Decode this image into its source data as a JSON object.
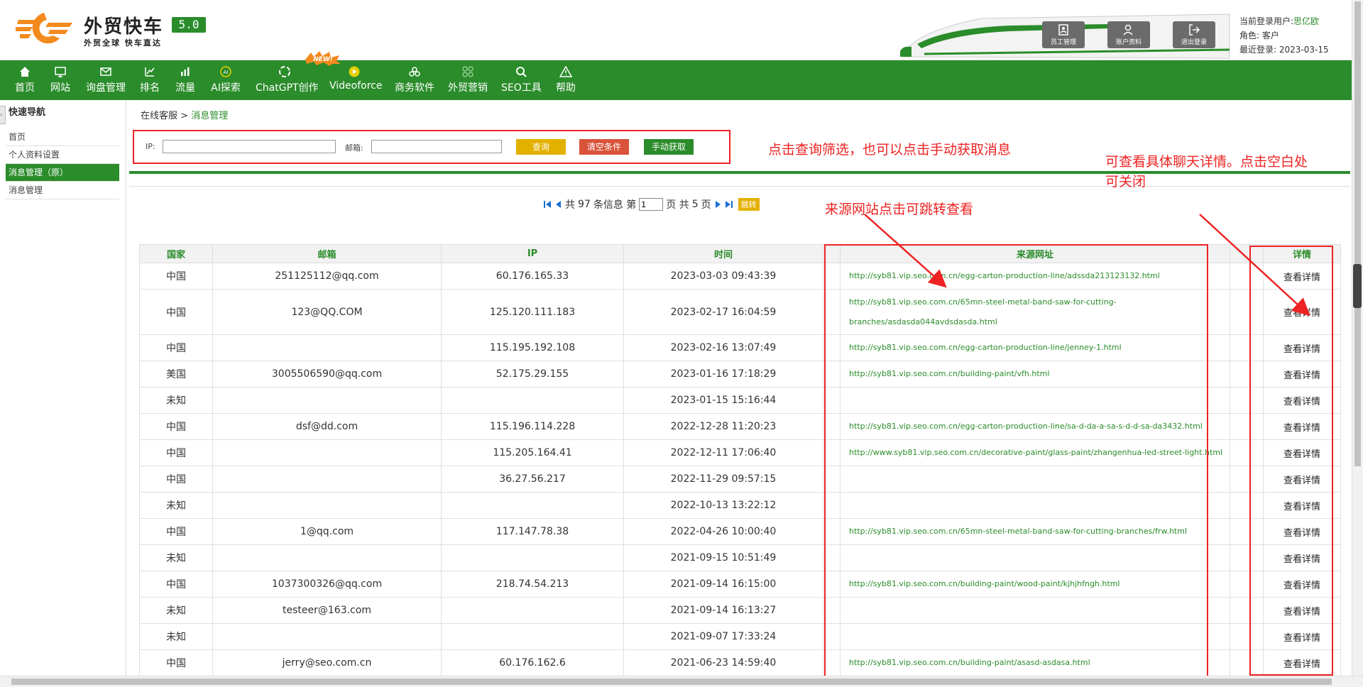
{
  "brand": {
    "title": "外贸快车",
    "version": "5.0",
    "slogan": "外贸全球 快车直达"
  },
  "header_buttons": [
    {
      "label": "员工管理",
      "icon": "staff-icon"
    },
    {
      "label": "账户资料",
      "icon": "account-icon"
    },
    {
      "label": "退出登录",
      "icon": "logout-icon"
    }
  ],
  "user": {
    "login_label": "当前登录用户:",
    "login_name": "思亿欧",
    "role_label": "角色:",
    "role": "客户",
    "last_label": "最近登录:",
    "last_date": "2023-03-15"
  },
  "nav": [
    {
      "label": "首页",
      "icon": "home-icon"
    },
    {
      "label": "网站",
      "icon": "monitor-icon"
    },
    {
      "label": "询盘管理",
      "icon": "mail-icon"
    },
    {
      "label": "排名",
      "icon": "ranking-icon"
    },
    {
      "label": "流量",
      "icon": "bar-chart-icon"
    },
    {
      "label": "AI探索",
      "icon": "ai-icon"
    },
    {
      "label": "ChatGPT创作",
      "icon": "chatgpt-icon"
    },
    {
      "label": "Videoforce",
      "icon": "play-icon"
    },
    {
      "label": "商务软件",
      "icon": "software-icon"
    },
    {
      "label": "外贸营销",
      "icon": "marketing-icon"
    },
    {
      "label": "SEO工具",
      "icon": "search-icon"
    },
    {
      "label": "帮助",
      "icon": "warning-icon"
    }
  ],
  "new_badge": "NEW!",
  "sidebar": {
    "title": "快速导航",
    "items": [
      {
        "label": "首页",
        "active": false
      },
      {
        "label": "个人资料设置",
        "active": false
      },
      {
        "label": "消息管理（原）",
        "active": true
      },
      {
        "label": "消息管理",
        "active": false
      }
    ]
  },
  "breadcrumb": {
    "parent": "在线客服",
    "sep": ">",
    "current": "消息管理"
  },
  "filter": {
    "ip_label": "IP:",
    "email_label": "邮箱:",
    "query": "查询",
    "clear": "清空条件",
    "manual": "手动获取"
  },
  "annotations": {
    "filter_note": "点击查询筛选，也可以点击手动获取消息",
    "url_note": "来源网站点击可跳转查看",
    "detail_note": "可查看具体聊天详情。点击空白处可关闭"
  },
  "pager": {
    "total_prefix": "共",
    "total": "97",
    "total_suffix": "条信息 第",
    "page": "1",
    "pages_prefix": "页 共",
    "pages": "5",
    "pages_suffix": "页",
    "jump": "跳转"
  },
  "table": {
    "headers": [
      "国家",
      "邮箱",
      "IP",
      "时间",
      "",
      "来源网址",
      "",
      "详情"
    ],
    "detail_label": "查看详情",
    "rows": [
      {
        "country": "中国",
        "email": "251125112@qq.com",
        "ip": "60.176.165.33",
        "time": "2023-03-03 09:43:39",
        "url": "http://syb81.vip.seo.com.cn/egg-carton-production-line/adssda213123132.html"
      },
      {
        "country": "中国",
        "email": "123@QQ.COM",
        "ip": "125.120.111.183",
        "time": "2023-02-17 16:04:59",
        "url": "http://syb81.vip.seo.com.cn/65mn-steel-metal-band-saw-for-cutting-branches/asdasda044avdsdasda.html"
      },
      {
        "country": "中国",
        "email": "",
        "ip": "115.195.192.108",
        "time": "2023-02-16 13:07:49",
        "url": "http://syb81.vip.seo.com.cn/egg-carton-production-line/jenney-1.html"
      },
      {
        "country": "美国",
        "email": "3005506590@qq.com",
        "ip": "52.175.29.155",
        "time": "2023-01-16 17:18:29",
        "url": "http://syb81.vip.seo.com.cn/building-paint/vfh.html"
      },
      {
        "country": "未知",
        "email": "",
        "ip": "",
        "time": "2023-01-15 15:16:44",
        "url": ""
      },
      {
        "country": "中国",
        "email": "dsf@dd.com",
        "ip": "115.196.114.228",
        "time": "2022-12-28 11:20:23",
        "url": "http://syb81.vip.seo.com.cn/egg-carton-production-line/sa-d-da-a-sa-s-d-d-sa-da3432.html"
      },
      {
        "country": "中国",
        "email": "",
        "ip": "115.205.164.41",
        "time": "2022-12-11 17:06:40",
        "url": "http://www.syb81.vip.seo.com.cn/decorative-paint/glass-paint/zhangenhua-led-street-light.html"
      },
      {
        "country": "中国",
        "email": "",
        "ip": "36.27.56.217",
        "time": "2022-11-29 09:57:15",
        "url": ""
      },
      {
        "country": "未知",
        "email": "",
        "ip": "",
        "time": "2022-10-13 13:22:12",
        "url": ""
      },
      {
        "country": "中国",
        "email": "1@qq.com",
        "ip": "117.147.78.38",
        "time": "2022-04-26 10:00:40",
        "url": "http://syb81.vip.seo.com.cn/65mn-steel-metal-band-saw-for-cutting-branches/frw.html"
      },
      {
        "country": "未知",
        "email": "",
        "ip": "",
        "time": "2021-09-15 10:51:49",
        "url": ""
      },
      {
        "country": "中国",
        "email": "1037300326@qq.com",
        "ip": "218.74.54.213",
        "time": "2021-09-14 16:15:00",
        "url": "http://syb81.vip.seo.com.cn/building-paint/wood-paint/kjhjhfngh.html"
      },
      {
        "country": "未知",
        "email": "testeer@163.com",
        "ip": "",
        "time": "2021-09-14 16:13:27",
        "url": ""
      },
      {
        "country": "未知",
        "email": "",
        "ip": "",
        "time": "2021-09-07 17:33:24",
        "url": ""
      },
      {
        "country": "中国",
        "email": "jerry@seo.com.cn",
        "ip": "60.176.162.6",
        "time": "2021-06-23 14:59:40",
        "url": "http://syb81.vip.seo.com.cn/building-paint/asasd-asdasa.html"
      }
    ]
  },
  "colors": {
    "brand_green": "#2a8c2a",
    "annotation_red": "#ee2222",
    "query_yellow": "#e3b000",
    "clear_red": "#d9533b"
  }
}
